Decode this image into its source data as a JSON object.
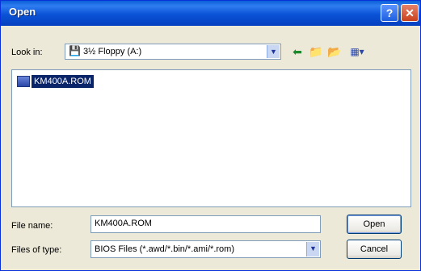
{
  "window": {
    "title": "Open",
    "help_glyph": "?",
    "close_glyph": "✕"
  },
  "lookin": {
    "label": "Look in:",
    "value": "3½ Floppy (A:)",
    "drive_icon_glyph": "💾"
  },
  "toolbar": {
    "back": "⬅",
    "up": "📁",
    "newfolder": "📂",
    "view": "▦▾"
  },
  "files": [
    {
      "name": "KM400A.ROM"
    }
  ],
  "filename": {
    "label": "File name:",
    "value": "KM400A.ROM"
  },
  "filetype": {
    "label": "Files of type:",
    "value": "BIOS Files (*.awd/*.bin/*.ami/*.rom)"
  },
  "buttons": {
    "open": "Open",
    "cancel": "Cancel"
  },
  "colors": {
    "title_bar": "#0a52d6",
    "selection": "#0a246a",
    "dialog_bg": "#ece9d8"
  }
}
